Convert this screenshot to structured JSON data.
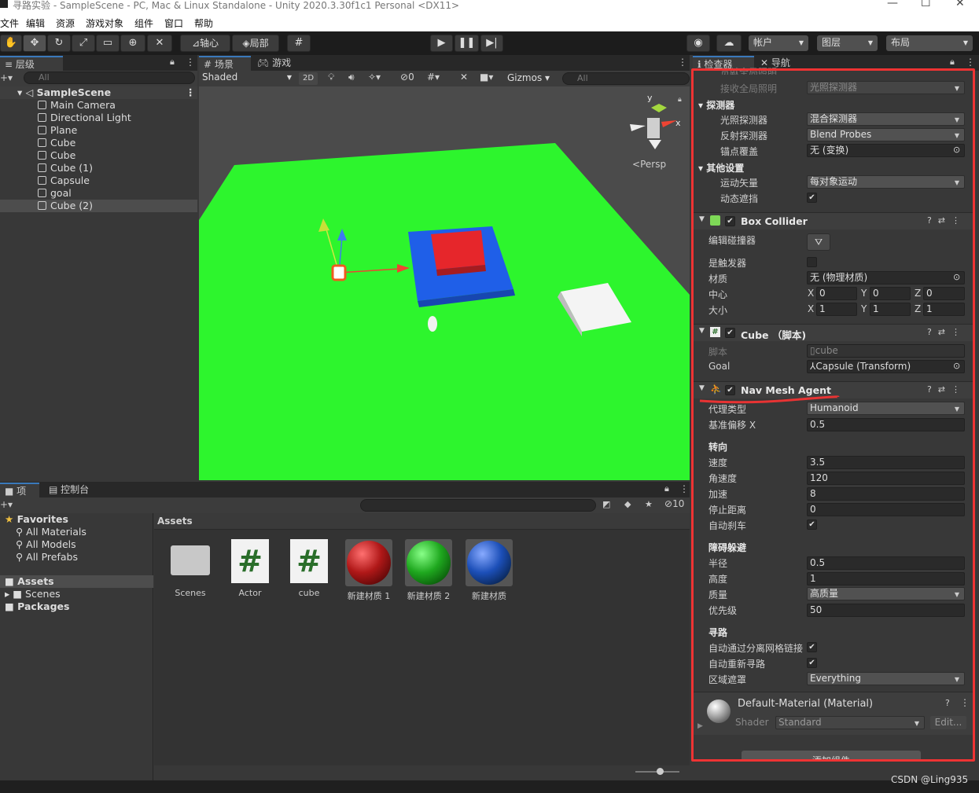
{
  "window": {
    "title": "寻路实验 - SampleScene - PC, Mac & Linux Standalone - Unity 2020.3.30f1c1 Personal <DX11>"
  },
  "menu": [
    "文件",
    "编辑",
    "资源",
    "游戏对象",
    "组件",
    "窗口",
    "帮助"
  ],
  "toolbar": {
    "pivot": "轴心",
    "local": "局部",
    "account": "帐户",
    "layers": "图层",
    "layout": "布局"
  },
  "hierarchy": {
    "tab": "层级",
    "search_placeholder": "All",
    "scene": "SampleScene",
    "items": [
      "Main Camera",
      "Directional Light",
      "Plane",
      "Cube",
      "Cube",
      "Cube (1)",
      "Capsule",
      "goal",
      "Cube (2)"
    ]
  },
  "scene_view": {
    "tab_scene": "场景",
    "tab_game": "游戏",
    "shading": "Shaded",
    "mode_2d": "2D",
    "hidden_count": "0",
    "gizmos": "Gizmos",
    "search_placeholder": "All",
    "persp": "Persp"
  },
  "project": {
    "tab_project": "项目",
    "tab_console": "控制台",
    "hidden_count": "10",
    "favorites": "Favorites",
    "fav_items": [
      "All Materials",
      "All Models",
      "All Prefabs"
    ],
    "assets_root": "Assets",
    "assets_children": [
      "Scenes"
    ],
    "packages": "Packages",
    "breadcrumb": "Assets",
    "assets": [
      {
        "name": "Scenes",
        "kind": "folder"
      },
      {
        "name": "Actor",
        "kind": "script"
      },
      {
        "name": "cube",
        "kind": "script"
      },
      {
        "name": "新建材质 1",
        "kind": "material",
        "color": "#b01818"
      },
      {
        "name": "新建材质 2",
        "kind": "material",
        "color": "#1fa81f"
      },
      {
        "name": "新建材质",
        "kind": "material",
        "color": "#1c4fb8"
      }
    ]
  },
  "inspector": {
    "tab_inspector": "检查器",
    "tab_nav": "导航",
    "cut_top": "贡献全局照明",
    "receive_gi": {
      "label": "接收全局照明",
      "value": "光照探测器"
    },
    "probes": {
      "title": "探测器",
      "light_probes": "光照探测器",
      "light_probes_val": "混合探测器",
      "reflection_probes": "反射探测器",
      "reflection_probes_val": "Blend Probes",
      "anchor": "锚点覆盖",
      "anchor_val": "无 (变换)"
    },
    "other": {
      "title": "其他设置",
      "motion": "运动矢量",
      "motion_val": "每对象运动",
      "occlusion": "动态遮挡"
    },
    "box_collider": {
      "title": "Box Collider",
      "edit": "编辑碰撞器",
      "trigger": "是触发器",
      "material": "材质",
      "material_val": "无 (物理材质)",
      "center": "中心",
      "center_vals": [
        "0",
        "0",
        "0"
      ],
      "size": "大小",
      "size_vals": [
        "1",
        "1",
        "1"
      ]
    },
    "cube_script": {
      "title": "Cube （脚本)",
      "script_label": "脚本",
      "script_val": "cube",
      "goal_label": "Goal",
      "goal_val": "Capsule (Transform)"
    },
    "nav_agent": {
      "title": "Nav Mesh Agent",
      "agent_type": "代理类型",
      "agent_type_val": "Humanoid",
      "base_offset": "基准偏移 X",
      "base_offset_val": "0.5",
      "steering": "转向",
      "speed": "速度",
      "speed_val": "3.5",
      "angular_speed": "角速度",
      "angular_speed_val": "120",
      "acceleration": "加速",
      "acceleration_val": "8",
      "stopping_distance": "停止距离",
      "stopping_distance_val": "0",
      "auto_braking": "自动刹车",
      "obstacle": "障碍躲避",
      "radius": "半径",
      "radius_val": "0.5",
      "height": "高度",
      "height_val": "1",
      "quality": "质量",
      "quality_val": "高质量",
      "priority": "优先级",
      "priority_val": "50",
      "pathfinding": "寻路",
      "auto_traverse": "自动通过分离网格链接",
      "auto_repath": "自动重新寻路",
      "area_mask": "区域遮罩",
      "area_mask_val": "Everything"
    },
    "material": {
      "title": "Default-Material (Material)",
      "shader_label": "Shader",
      "shader_val": "Standard",
      "edit": "Edit..."
    },
    "add_component": "添加组件"
  },
  "watermark": "CSDN @Ling935",
  "colors": {
    "highlight_red": "#e83333",
    "plane_green": "#2df52d",
    "accent_blue": "#3a79bb"
  }
}
